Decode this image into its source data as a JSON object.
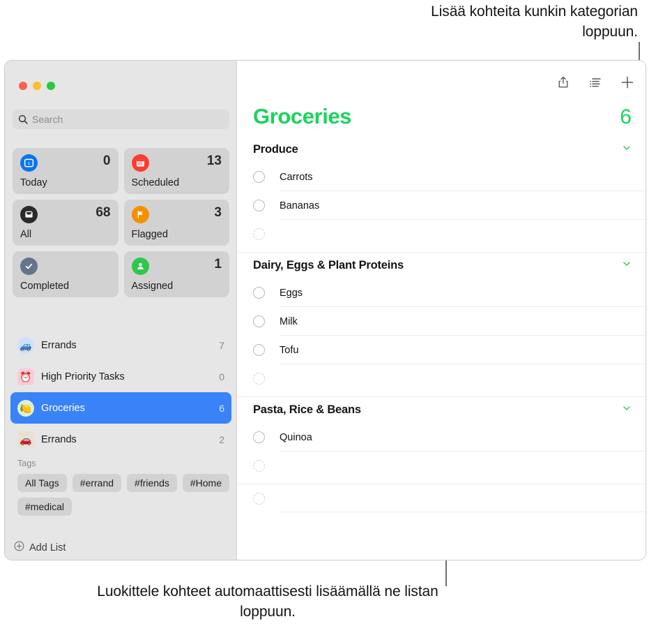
{
  "callouts": {
    "top": "Lisää kohteita kunkin kategorian loppuun.",
    "bottom": "Luokittele kohteet automaattisesti lisäämällä ne listan loppuun."
  },
  "window": {
    "traffic_lights": [
      "close",
      "minimize",
      "zoom"
    ]
  },
  "sidebar": {
    "search": {
      "placeholder": "Search",
      "value": "",
      "icon": "search-icon"
    },
    "smart_lists": [
      {
        "label": "Today",
        "count": "0",
        "icon": "calendar-today-icon",
        "color": "#0a74f0"
      },
      {
        "label": "Scheduled",
        "count": "13",
        "icon": "calendar-icon",
        "color": "#ff3b30"
      },
      {
        "label": "All",
        "count": "68",
        "icon": "inbox-icon",
        "color": "#2b2b2b"
      },
      {
        "label": "Flagged",
        "count": "3",
        "icon": "flag-icon",
        "color": "#f59000"
      },
      {
        "label": "Completed",
        "count": "",
        "icon": "checkmark-icon",
        "color": "#64748b"
      },
      {
        "label": "Assigned",
        "count": "1",
        "icon": "person-icon",
        "color": "#2ec84c"
      }
    ],
    "lists": [
      {
        "label": "Errands",
        "count": "7",
        "icon": "car-blue-emoji",
        "glyph": "🚙",
        "bg": "#cfe0f8",
        "selected": false
      },
      {
        "label": "High Priority Tasks",
        "count": "0",
        "icon": "alarm-clock-emoji",
        "glyph": "⏰",
        "bg": "#f9ccd8",
        "selected": false
      },
      {
        "label": "Groceries",
        "count": "6",
        "icon": "lemon-emoji",
        "glyph": "🍋",
        "bg": "#dff0cf",
        "selected": true
      },
      {
        "label": "Errands",
        "count": "2",
        "icon": "car-red-emoji",
        "glyph": "🚗",
        "bg": "#e8e0d2",
        "selected": false
      }
    ],
    "tags_title": "Tags",
    "tags": [
      "All Tags",
      "#errand",
      "#friends",
      "#Home",
      "#medical"
    ],
    "add_list": {
      "label": "Add List",
      "icon": "plus-circle-icon"
    }
  },
  "main": {
    "toolbar": [
      {
        "name": "share-icon",
        "label": "Share"
      },
      {
        "name": "list-view-icon",
        "label": "View as List"
      },
      {
        "name": "plus-icon",
        "label": "New Reminder"
      }
    ],
    "list_title": "Groceries",
    "list_count": "6",
    "accent_color": "#19d45a",
    "sections": [
      {
        "name": "Produce",
        "chevron": "chevron-down-icon",
        "items": [
          {
            "text": "Carrots",
            "state": "open"
          },
          {
            "text": "Bananas",
            "state": "open"
          },
          {
            "text": "",
            "state": "new"
          }
        ]
      },
      {
        "name": "Dairy, Eggs & Plant Proteins",
        "chevron": "chevron-down-icon",
        "items": [
          {
            "text": "Eggs",
            "state": "open"
          },
          {
            "text": "Milk",
            "state": "open"
          },
          {
            "text": "Tofu",
            "state": "open"
          },
          {
            "text": "",
            "state": "new"
          }
        ]
      },
      {
        "name": "Pasta, Rice & Beans",
        "chevron": "chevron-down-icon",
        "items": [
          {
            "text": "Quinoa",
            "state": "open"
          },
          {
            "text": "",
            "state": "new"
          }
        ]
      },
      {
        "name": "",
        "chevron": "",
        "items": [
          {
            "text": "",
            "state": "new"
          }
        ]
      }
    ]
  }
}
